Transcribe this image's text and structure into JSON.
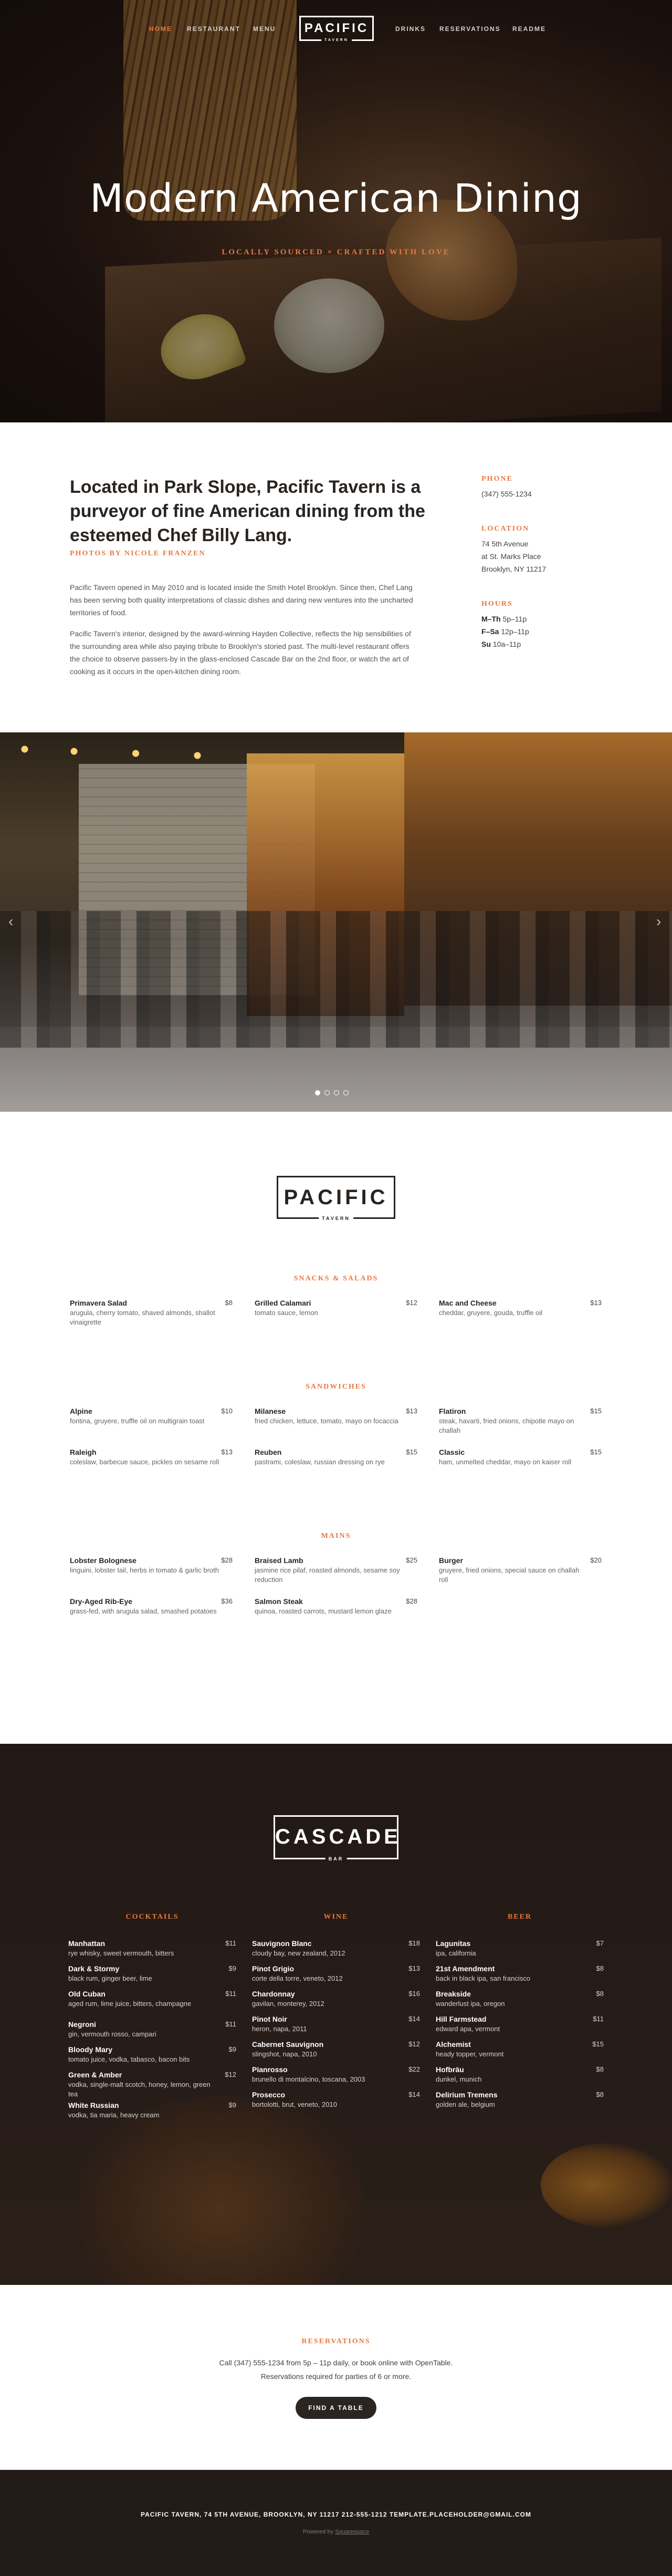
{
  "nav": {
    "left": [
      "Home",
      "Restaurant",
      "Menu"
    ],
    "right": [
      "Drinks",
      "Reservations",
      "Readme"
    ],
    "logo": "PACIFIC",
    "logo_sub": "TAVERN"
  },
  "hero": {
    "title": "Modern American Dining",
    "tagline": "LOCALLY SOURCED × CRAFTED WITH LOVE"
  },
  "about": {
    "heading": "Located in Park Slope, Pacific Tavern is a purveyor of fine American dining from the esteemed Chef Billy Lang.",
    "credit": "PHOTOS BY NICOLE FRANZEN",
    "p1": "Pacific Tavern opened in May 2010 and is located inside the Smith Hotel Brooklyn. Since then, Chef Lang has been serving both quality interpretations of classic dishes and daring new ventures into the uncharted territories of food.",
    "p2": "Pacific Tavern's interior, designed by the award-winning Hayden Collective, reflects the hip sensibilities of the surrounding area while also paying tribute to Brooklyn's storied past. The multi-level restaurant offers the choice to observe passers-by in the glass-enclosed Cascade Bar on the 2nd floor, or watch the art of cooking as it occurs in the open-kitchen dining room.",
    "phone_label": "PHONE",
    "phone": "(347) 555-1234",
    "location_label": "LOCATION",
    "location_lines": [
      "74 5th Avenue",
      "at St. Marks Place",
      "Brooklyn, NY 11217"
    ],
    "hours_label": "HOURS",
    "hours": [
      {
        "day": "M–Th",
        "time": "5p–11p"
      },
      {
        "day": "F–Sa",
        "time": "12p–11p"
      },
      {
        "day": "Su",
        "time": "10a–11p"
      }
    ]
  },
  "slideshow": {
    "slides": 4,
    "active": 1
  },
  "menu": {
    "logo": "PACIFIC",
    "logo_sub": "TAVERN",
    "sections": [
      {
        "title": "SNACKS & SALADS",
        "items": [
          {
            "name": "Primavera Salad",
            "price": "$8",
            "desc": "arugula, cherry tomato, shaved almonds, shallot vinaigrette"
          },
          {
            "name": "Grilled Calamari",
            "price": "$12",
            "desc": "tomato sauce, lemon"
          },
          {
            "name": "Mac and Cheese",
            "price": "$13",
            "desc": "cheddar, gruyere, gouda, truffle oil"
          }
        ]
      },
      {
        "title": "SANDWICHES",
        "items": [
          {
            "name": "Alpine",
            "price": "$10",
            "desc": "fontina, gruyere, truffle oil on multigrain toast"
          },
          {
            "name": "Milanese",
            "price": "$13",
            "desc": "fried chicken, lettuce, tomato, mayo on focaccia"
          },
          {
            "name": "Flatiron",
            "price": "$15",
            "desc": "steak, havarti, fried onions, chipotle mayo on challah"
          },
          {
            "name": "Raleigh",
            "price": "$13",
            "desc": "coleslaw, barbecue sauce, pickles on sesame roll"
          },
          {
            "name": "Reuben",
            "price": "$15",
            "desc": "pastrami, coleslaw, russian dressing on rye"
          },
          {
            "name": "Classic",
            "price": "$15",
            "desc": "ham, unmelted cheddar, mayo on kaiser roll"
          }
        ]
      },
      {
        "title": "MAINS",
        "items": [
          {
            "name": "Lobster Bolognese",
            "price": "$28",
            "desc": "linguini, lobster tail, herbs in tomato & garlic broth"
          },
          {
            "name": "Braised Lamb",
            "price": "$25",
            "desc": "jasmine rice pilaf, roasted almonds, sesame soy reduction"
          },
          {
            "name": "Burger",
            "price": "$20",
            "desc": "gruyere, fried onions, special sauce on challah roll"
          },
          {
            "name": "Dry-Aged Rib-Eye",
            "price": "$36",
            "desc": "grass-fed, with arugula salad, smashed potatoes"
          },
          {
            "name": "Salmon Steak",
            "price": "$28",
            "desc": "quinoa, roasted carrots, mustard lemon glaze"
          }
        ]
      }
    ]
  },
  "bar": {
    "logo": "CASCADE",
    "logo_sub": "BAR",
    "columns": [
      {
        "title": "COCKTAILS",
        "items": [
          {
            "name": "Manhattan",
            "price": "$11",
            "desc": "rye whisky, sweet vermouth, bitters"
          },
          {
            "name": "Dark & Stormy",
            "price": "$9",
            "desc": "black rum, ginger beer, lime"
          },
          {
            "name": "Old Cuban",
            "price": "$11",
            "desc": "aged rum, lime juice, bitters, champagne"
          },
          {
            "name": "Negroni",
            "price": "$11",
            "desc": "gin, vermouth rosso, campari"
          },
          {
            "name": "Bloody Mary",
            "price": "$9",
            "desc": "tomato juice, vodka, tabasco, bacon bits"
          },
          {
            "name": "Green & Amber",
            "price": "$12",
            "desc": "vodka, single-malt scotch, honey, lemon, green tea"
          },
          {
            "name": "White Russian",
            "price": "$9",
            "desc": "vodka, tia maria, heavy cream"
          }
        ]
      },
      {
        "title": "WINE",
        "items": [
          {
            "name": "Sauvignon Blanc",
            "price": "$18",
            "desc": "cloudy bay, new zealand, 2012"
          },
          {
            "name": "Pinot Grigio",
            "price": "$13",
            "desc": "corte della torre, veneto, 2012"
          },
          {
            "name": "Chardonnay",
            "price": "$16",
            "desc": "gavilan, monterey, 2012"
          },
          {
            "name": "Pinot Noir",
            "price": "$14",
            "desc": "heron, napa, 2011"
          },
          {
            "name": "Cabernet Sauvignon",
            "price": "$12",
            "desc": "slingshot, napa, 2010"
          },
          {
            "name": "Pianrosso",
            "price": "$22",
            "desc": "brunello di montalcino, toscana, 2003"
          },
          {
            "name": "Prosecco",
            "price": "$14",
            "desc": "bortolotti, brut, veneto, 2010"
          }
        ]
      },
      {
        "title": "BEER",
        "items": [
          {
            "name": "Lagunitas",
            "price": "$7",
            "desc": "ipa, california"
          },
          {
            "name": "21st Amendment",
            "price": "$8",
            "desc": "back in black ipa, san francisco"
          },
          {
            "name": "Breakside",
            "price": "$8",
            "desc": "wanderlust ipa, oregon"
          },
          {
            "name": "Hill Farmstead",
            "price": "$11",
            "desc": "edward apa, vermont"
          },
          {
            "name": "Alchemist",
            "price": "$15",
            "desc": "heady topper, vermont"
          },
          {
            "name": "Hofbräu",
            "price": "$8",
            "desc": "dunkel, munich"
          },
          {
            "name": "Delirium Tremens",
            "price": "$8",
            "desc": "golden ale, belgium"
          }
        ]
      }
    ]
  },
  "reservations": {
    "title": "RESERVATIONS",
    "line1": "Call (347) 555-1234 from 5p – 11p daily, or book online with OpenTable.",
    "line2": "Reservations required for parties of 6 or more.",
    "button": "FIND A TABLE"
  },
  "footer": {
    "line": "PACIFIC TAVERN, 74 5TH AVENUE, BROOKLYN, NY 11217   212-555-1212   TEMPLATE.PLACEHOLDER@GMAIL.COM",
    "powered_prefix": "Powered by",
    "powered_link": "Squarespace"
  },
  "colors": {
    "accent": "#e8783f",
    "dark": "#231b17"
  }
}
